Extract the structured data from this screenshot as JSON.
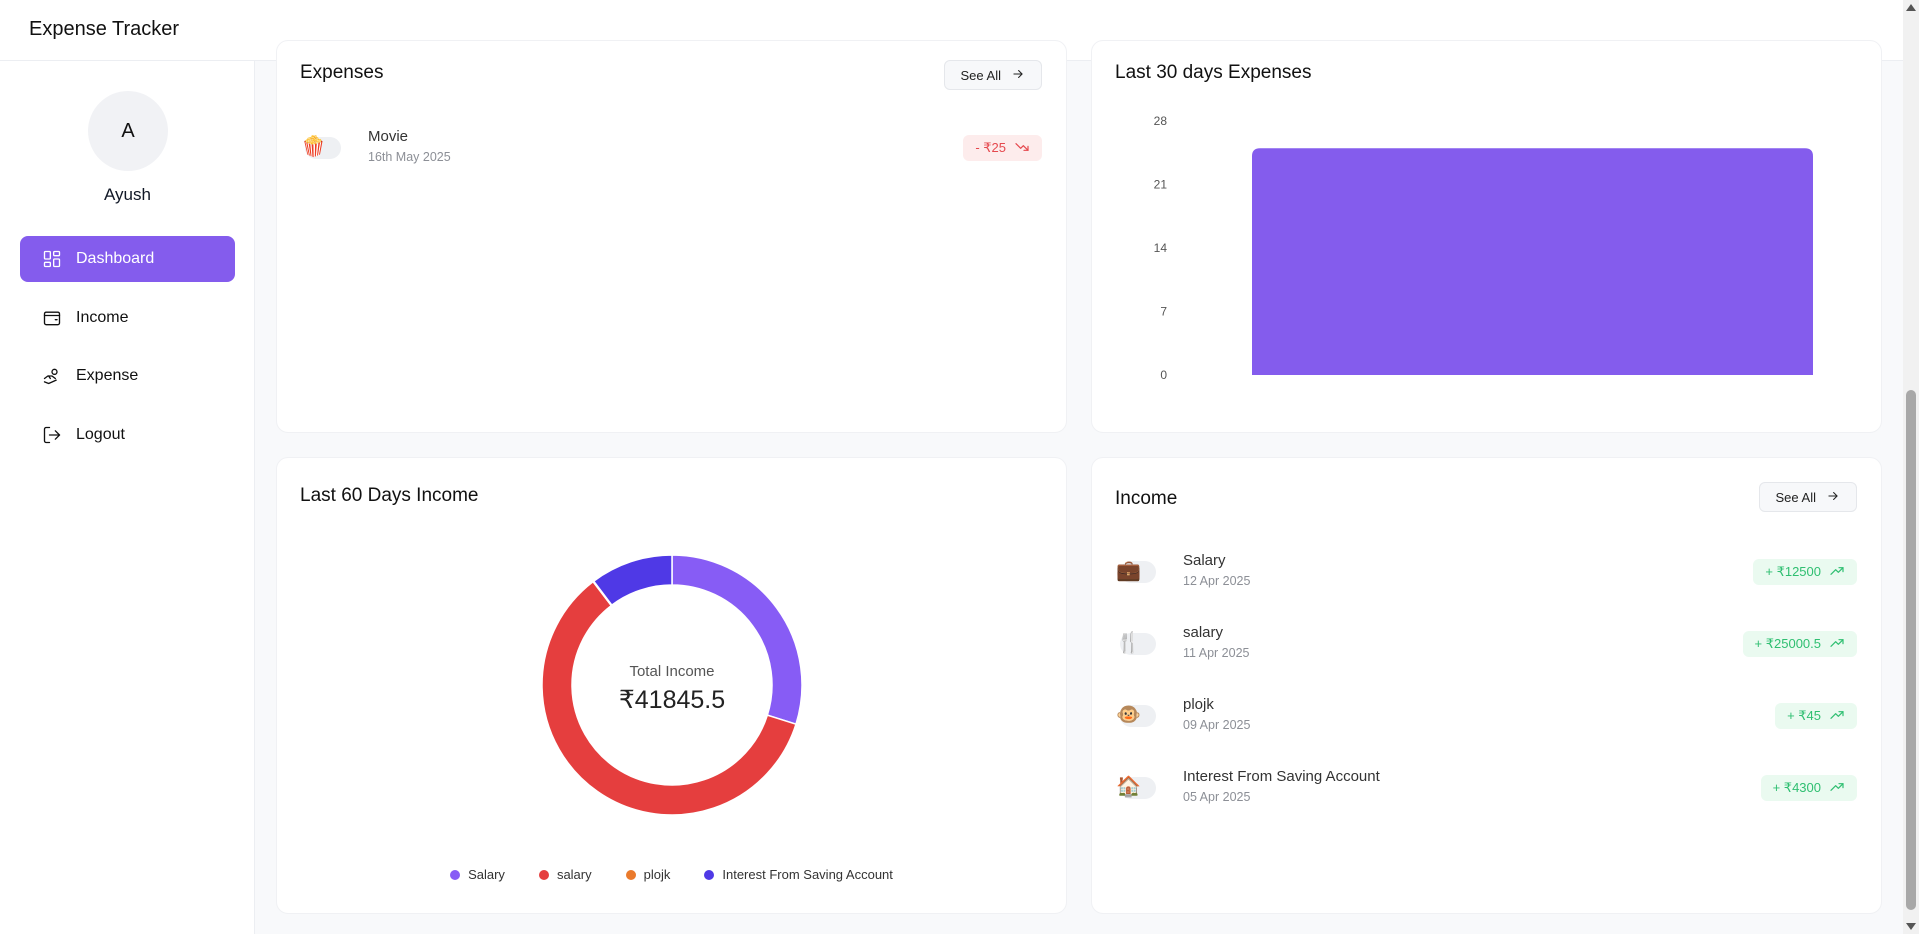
{
  "app": {
    "title": "Expense Tracker"
  },
  "user": {
    "initial": "A",
    "name": "Ayush"
  },
  "sidebar": {
    "items": [
      {
        "label": "Dashboard",
        "icon": "dashboard-icon",
        "active": true
      },
      {
        "label": "Income",
        "icon": "wallet-icon",
        "active": false
      },
      {
        "label": "Expense",
        "icon": "hand-coins-icon",
        "active": false
      },
      {
        "label": "Logout",
        "icon": "logout-icon",
        "active": false
      }
    ]
  },
  "expenses_card": {
    "title": "Expenses",
    "see_all": "See All",
    "items": [
      {
        "name": "Movie",
        "date": "16th May 2025",
        "amount": "- ₹25",
        "emoji": "🍿"
      }
    ]
  },
  "last30": {
    "title": "Last 30 days Expenses",
    "chart_data": {
      "type": "bar",
      "categories": [
        ""
      ],
      "values": [
        25
      ],
      "ylim": [
        0,
        28
      ],
      "yticks": [
        "28",
        "21",
        "14",
        "7",
        "0"
      ],
      "color": "#845ced"
    }
  },
  "last60": {
    "title": "Last 60 Days Income",
    "center_label": "Total Income",
    "center_value": "₹41845.5",
    "chart_data": {
      "type": "pie",
      "categories": [
        "Salary",
        "salary",
        "plojk",
        "Interest From Saving Account"
      ],
      "values": [
        12500,
        25000.5,
        45,
        4300
      ],
      "colors": [
        "#875cf5",
        "#e53e3e",
        "#ea7a2c",
        "#4f39e6"
      ]
    }
  },
  "income_card": {
    "title": "Income",
    "see_all": "See All",
    "items": [
      {
        "name": "Salary",
        "date": "12 Apr 2025",
        "amount": "+ ₹12500",
        "emoji": "💼"
      },
      {
        "name": "salary",
        "date": "11 Apr 2025",
        "amount": "+ ₹25000.5",
        "emoji": "🍴"
      },
      {
        "name": "plojk",
        "date": "09 Apr 2025",
        "amount": "+ ₹45",
        "emoji": "🐵"
      },
      {
        "name": "Interest From Saving Account",
        "date": "05 Apr 2025",
        "amount": "+ ₹4300",
        "emoji": "🏠"
      }
    ]
  }
}
